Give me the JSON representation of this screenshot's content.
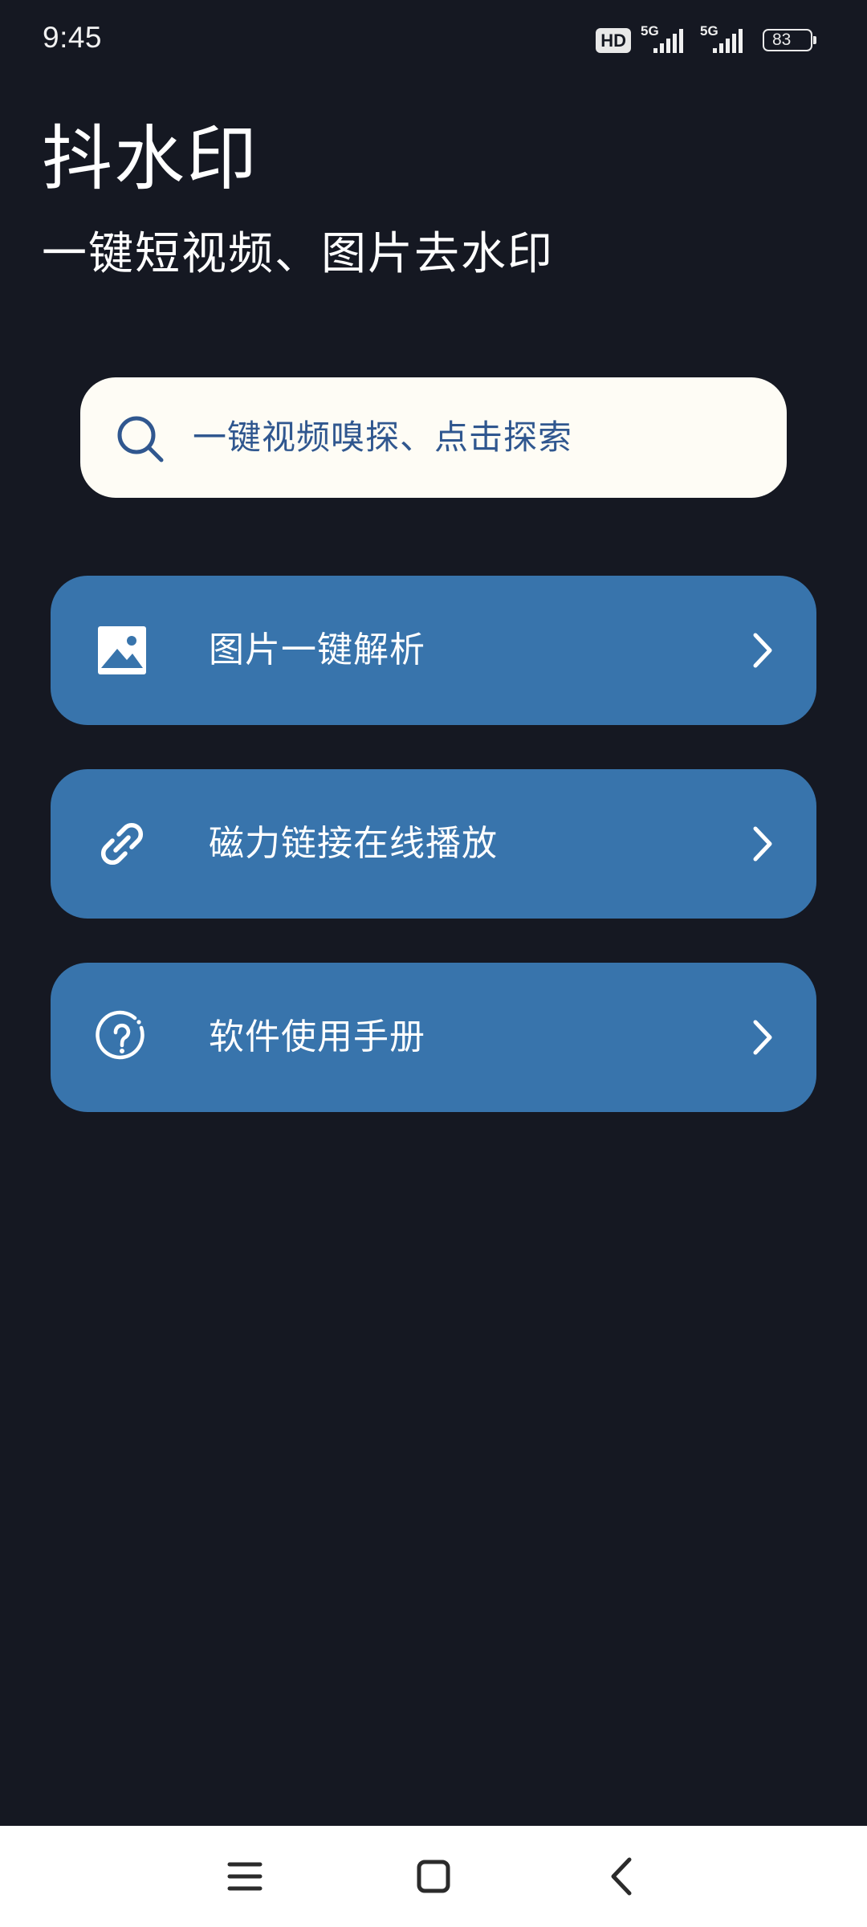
{
  "status_bar": {
    "time": "9:45",
    "hd_label": "HD",
    "network_1": "5G",
    "network_2": "5G",
    "battery_level": "83"
  },
  "header": {
    "title": "抖水印",
    "subtitle": "一键短视频、图片去水印"
  },
  "search": {
    "placeholder": "一键视频嗅探、点击探索",
    "icon": "search-icon"
  },
  "menu": [
    {
      "label": "图片一键解析",
      "icon": "image-icon"
    },
    {
      "label": "磁力链接在线播放",
      "icon": "link-icon"
    },
    {
      "label": "软件使用手册",
      "icon": "help-circle-icon"
    }
  ],
  "nav": {
    "items": [
      "menu-icon",
      "home-icon",
      "back-icon"
    ]
  },
  "colors": {
    "background": "#151822",
    "card": "#3874ac",
    "search_bg": "#fefcf5",
    "search_text": "#30578f"
  }
}
